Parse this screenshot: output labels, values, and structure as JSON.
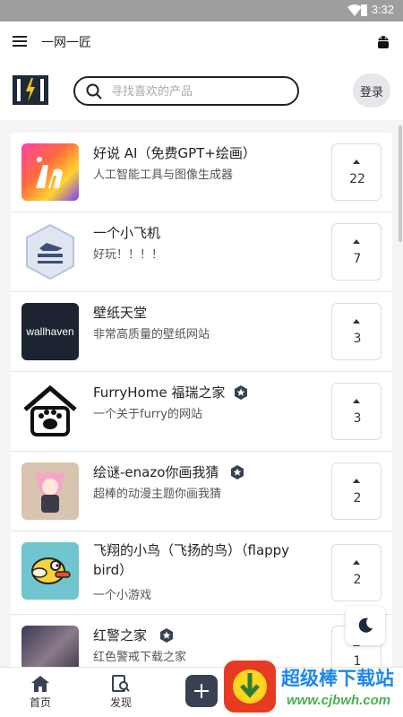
{
  "status_bar": {
    "time": "3:32"
  },
  "app_bar": {
    "title": "一网一匠"
  },
  "header": {
    "search_placeholder": "寻找喜欢的产品",
    "login_label": "登录"
  },
  "products": [
    {
      "name": "好说 AI（免费GPT+绘画）",
      "desc": "人工智能工具与图像生成器",
      "votes": "22",
      "featured": false
    },
    {
      "name": "一个小飞机",
      "desc": "好玩！！！！",
      "votes": "7",
      "featured": false
    },
    {
      "name": "壁纸天堂",
      "desc": "非常高质量的壁纸网站",
      "votes": "3",
      "featured": false,
      "thumb_text": "wallhaven"
    },
    {
      "name": "FurryHome 福瑞之家",
      "desc": "一个关于furry的网站",
      "votes": "3",
      "featured": true
    },
    {
      "name": "绘谜-enazo你画我猜",
      "desc": "超棒的动漫主题你画我猜",
      "votes": "2",
      "featured": true
    },
    {
      "name": "飞翔的小鸟（飞扬的鸟）（flappy bird）",
      "desc": "一个小游戏",
      "votes": "2",
      "featured": false
    },
    {
      "name": "红警之家",
      "desc": "红色警戒下载之家",
      "votes": "1",
      "featured": true
    }
  ],
  "tabs": {
    "home": "首页",
    "discover": "发现"
  },
  "watermark": {
    "title": "超级棒下载站",
    "url": "www.cjbwh.com"
  },
  "colors": {
    "accent": "#374151",
    "brand_dark": "#1f2937"
  }
}
